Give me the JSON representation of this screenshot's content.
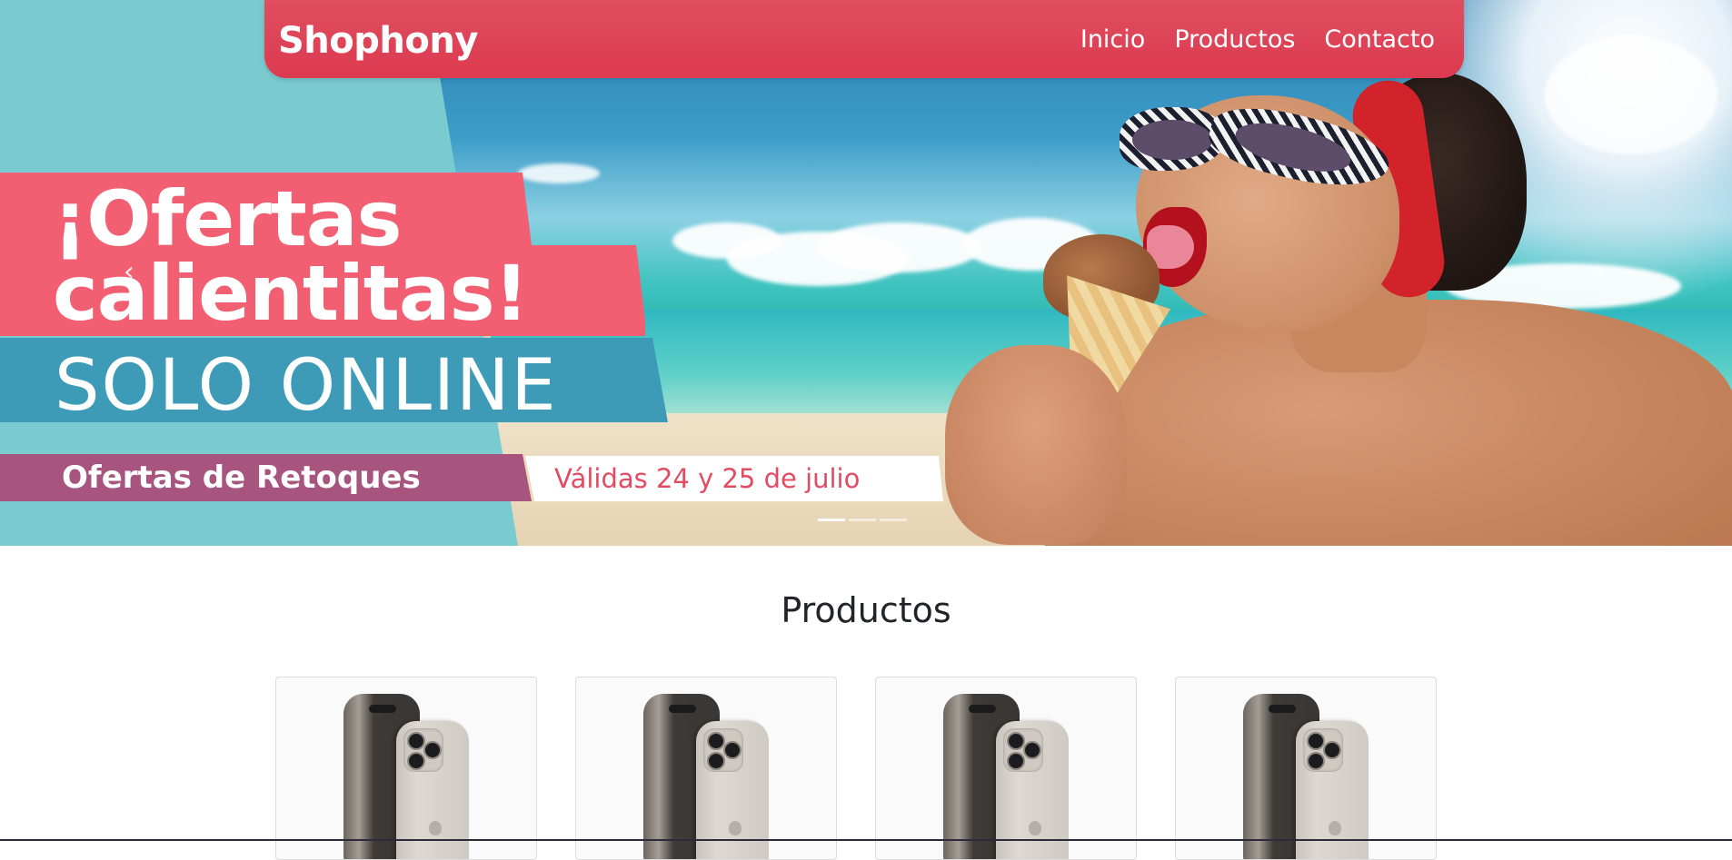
{
  "navbar": {
    "brand": "Shophony",
    "links": [
      "Inicio",
      "Productos",
      "Contacto"
    ]
  },
  "hero": {
    "title_line1": "¡Ofertas",
    "title_line2": "calientitas!",
    "subtitle": "SOLO ONLINE",
    "tag_left": "Ofertas de Retoques",
    "tag_right": "Válidas 24 y 25 de julio",
    "prev_label": "‹",
    "next_label": "›",
    "slide_count": 3,
    "active_slide": 1
  },
  "products": {
    "title": "Productos",
    "items": [
      {
        "image": "iphone-titanium"
      },
      {
        "image": "iphone-titanium"
      },
      {
        "image": "iphone-titanium"
      },
      {
        "image": "iphone-titanium"
      }
    ]
  },
  "colors": {
    "navbar": "#dc3a4f",
    "promo_pink": "#f25f72",
    "promo_blue": "#3d9bb7",
    "promo_purple": "#a7557f",
    "teal_panel": "#7acbd0"
  }
}
